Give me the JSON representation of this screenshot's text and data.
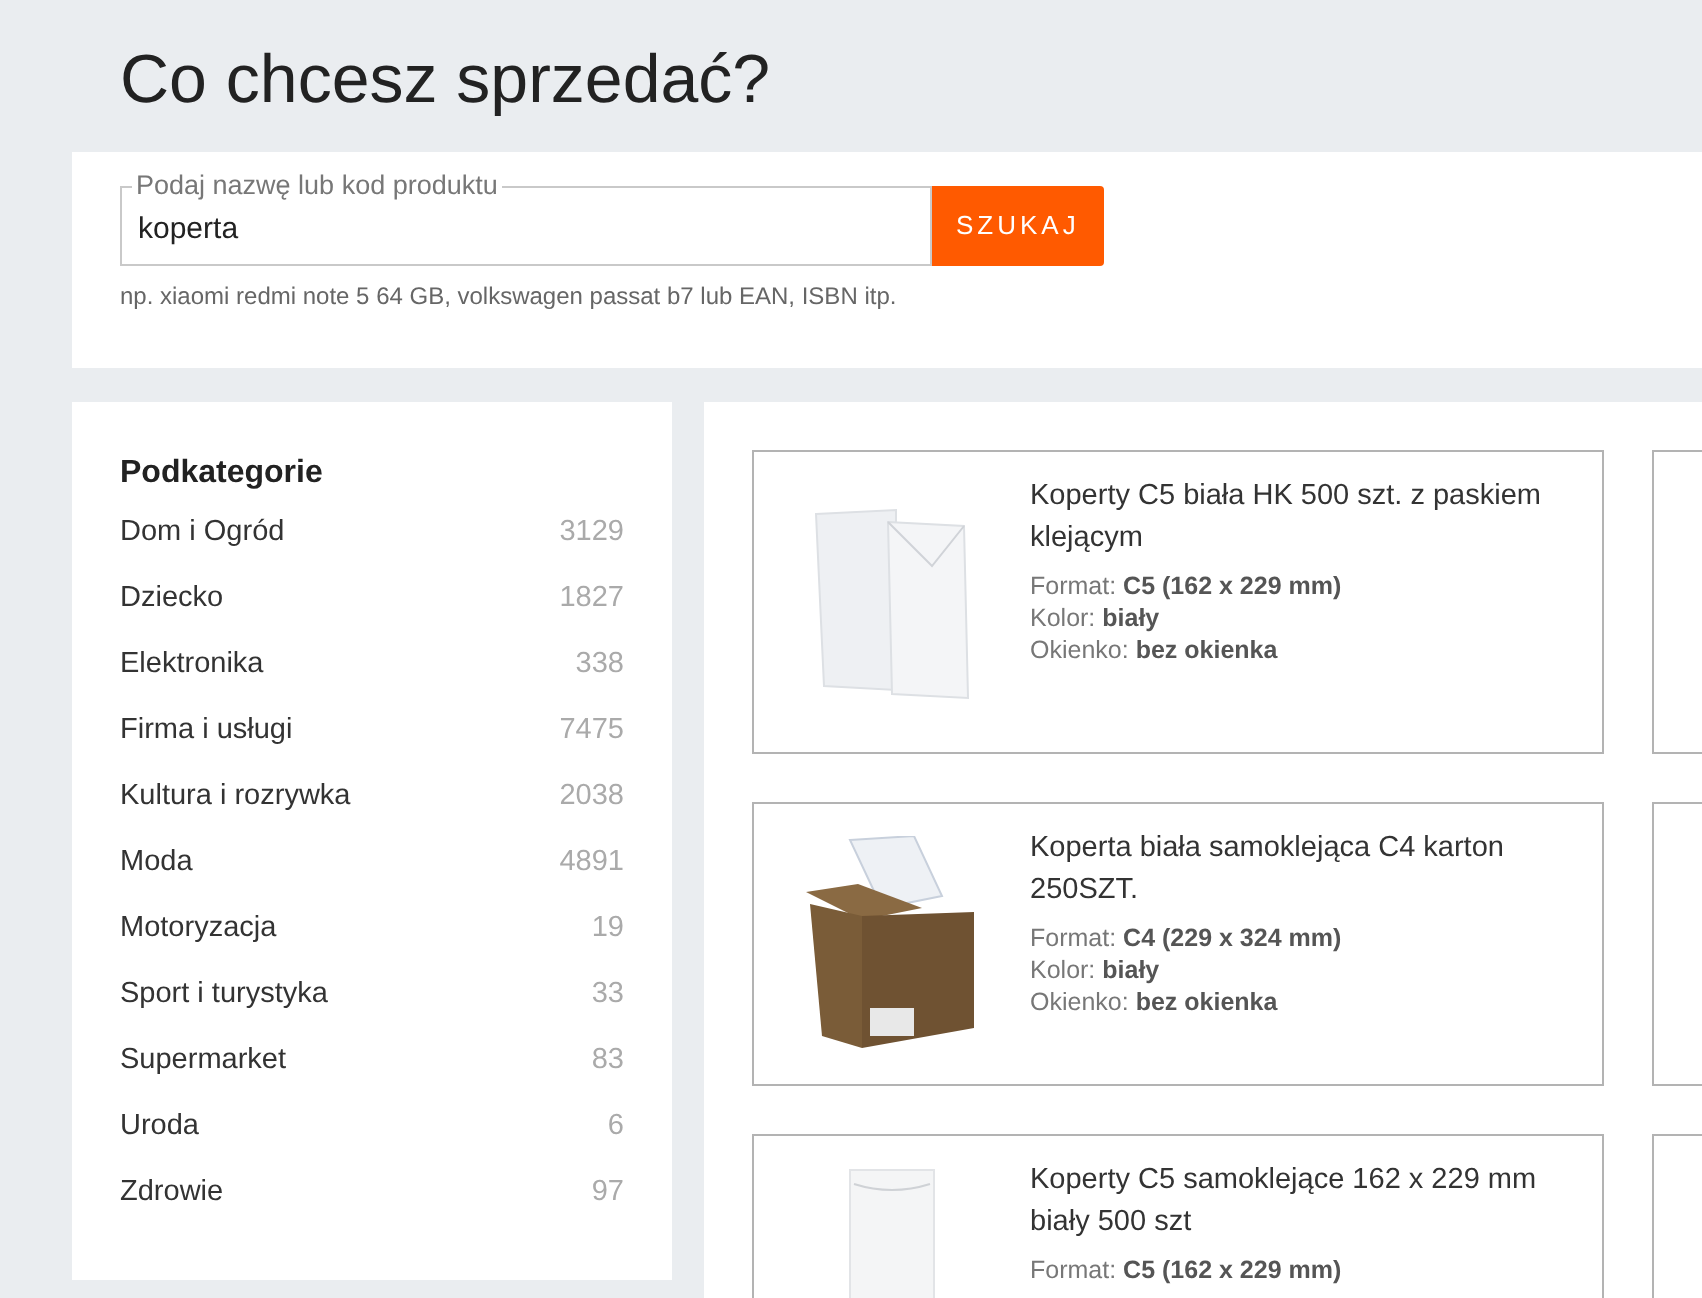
{
  "page_title": "Co chcesz sprzedać?",
  "search": {
    "label": "Podaj nazwę lub kod produktu",
    "value": "koperta",
    "button": "SZUKAJ",
    "hint": "np. xiaomi redmi note 5 64 GB, volkswagen passat b7 lub EAN, ISBN itp."
  },
  "sidebar": {
    "title": "Podkategorie",
    "items": [
      {
        "label": "Dom i Ogród",
        "count": "3129"
      },
      {
        "label": "Dziecko",
        "count": "1827"
      },
      {
        "label": "Elektronika",
        "count": "338"
      },
      {
        "label": "Firma i usługi",
        "count": "7475"
      },
      {
        "label": "Kultura i rozrywka",
        "count": "2038"
      },
      {
        "label": "Moda",
        "count": "4891"
      },
      {
        "label": "Motoryzacja",
        "count": "19"
      },
      {
        "label": "Sport i turystyka",
        "count": "33"
      },
      {
        "label": "Supermarket",
        "count": "83"
      },
      {
        "label": "Uroda",
        "count": "6"
      },
      {
        "label": "Zdrowie",
        "count": "97"
      }
    ]
  },
  "products": [
    {
      "kind": "envelope",
      "title": "Koperty C5 biała HK 500 szt. z paskiem klejącym",
      "details": [
        {
          "label": "Format:",
          "value": "C5 (162 x 229 mm)"
        },
        {
          "label": "Kolor:",
          "value": "biały"
        },
        {
          "label": "Okienko:",
          "value": "bez okienka"
        }
      ]
    },
    {
      "kind": "box",
      "title": "Koperta biała samoklejąca C4 karton 250SZT.",
      "details": [
        {
          "label": "Format:",
          "value": "C4 (229 x 324 mm)"
        },
        {
          "label": "Kolor:",
          "value": "biały"
        },
        {
          "label": "Okienko:",
          "value": "bez okienka"
        }
      ]
    },
    {
      "kind": "flap",
      "title": "Koperty C5 samoklejące 162 x 229 mm biały 500 szt",
      "details": [
        {
          "label": "Format:",
          "value": "C5 (162 x 229 mm)"
        }
      ]
    }
  ]
}
